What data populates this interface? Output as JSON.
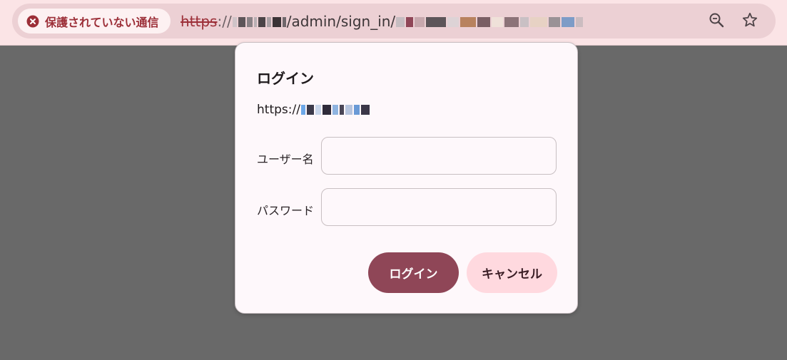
{
  "browser": {
    "security_label": "保護されていない通信",
    "url": {
      "scheme": "https",
      "separator": "://",
      "path": "/admin/sign_in/"
    },
    "icons": {
      "security": "warning-circle-icon",
      "zoom": "zoom-icon",
      "bookmark": "star-icon"
    }
  },
  "dialog": {
    "title": "ログイン",
    "origin_prefix": "https://",
    "username_label": "ユーザー名",
    "username_value": "",
    "password_label": "パスワード",
    "password_value": "",
    "login_button": "ログイン",
    "cancel_button": "キャンセル"
  },
  "colors": {
    "page_overlay": "#696969",
    "toolbar_bg": "#fbe4e6",
    "warning": "#9c2f38",
    "primary_button": "#8f4657",
    "secondary_button": "#ffd9df"
  }
}
